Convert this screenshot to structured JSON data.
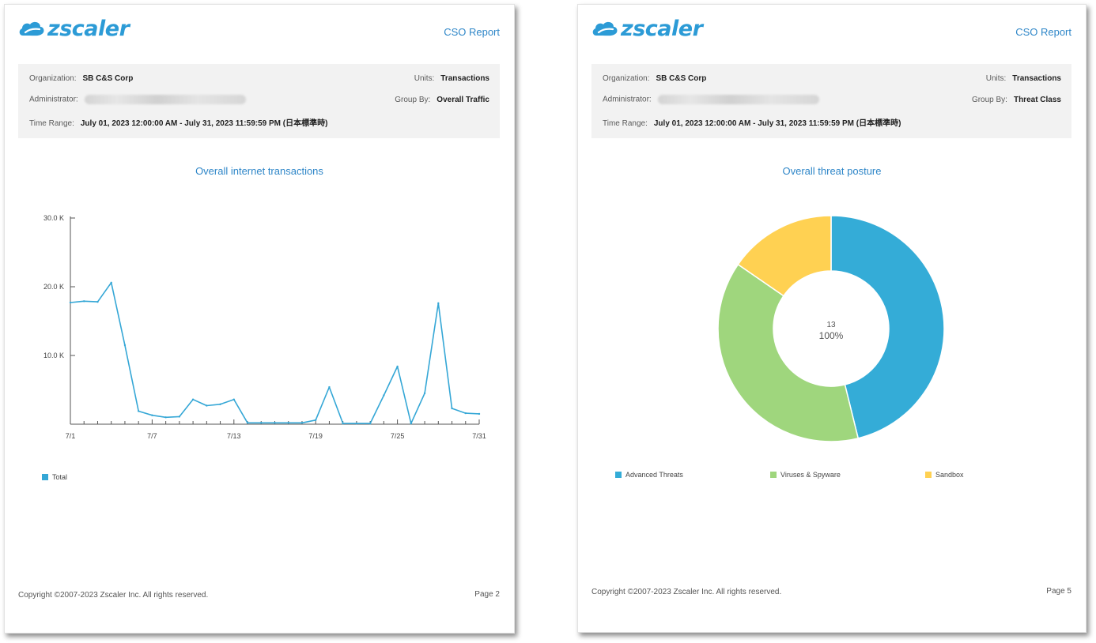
{
  "brand": {
    "name": "zscaler",
    "color": "#2c9bd6"
  },
  "left_page": {
    "report_title": "CSO Report",
    "info": {
      "org_label": "Organization:",
      "org_value": "SB C&S Corp",
      "units_label": "Units:",
      "units_value": "Transactions",
      "admin_label": "Administrator:",
      "group_label": "Group By:",
      "group_value": "Overall Traffic",
      "time_label": "Time Range:",
      "time_value": "July 01, 2023 12:00:00 AM - July 31, 2023 11:59:59 PM (日本標準時)"
    },
    "chart_title": "Overall internet transactions",
    "legend_label": "Total",
    "footer_copyright": "Copyright ©2007-2023 Zscaler Inc. All rights reserved.",
    "footer_page": "Page 2"
  },
  "right_page": {
    "report_title": "CSO Report",
    "info": {
      "org_label": "Organization:",
      "org_value": "SB C&S Corp",
      "units_label": "Units:",
      "units_value": "Transactions",
      "admin_label": "Administrator:",
      "group_label": "Group By:",
      "group_value": "Threat Class",
      "time_label": "Time Range:",
      "time_value": "July 01, 2023 12:00:00 AM - July 31, 2023 11:59:59 PM (日本標準時)"
    },
    "chart_title": "Overall threat posture",
    "center_count": "13",
    "center_percent": "100%",
    "footer_copyright": "Copyright ©2007-2023 Zscaler Inc. All rights reserved.",
    "footer_page": "Page 5"
  },
  "chart_data": [
    {
      "type": "line",
      "title": "Overall internet transactions",
      "x": [
        "7/1",
        "7/2",
        "7/3",
        "7/4",
        "7/5",
        "7/6",
        "7/7",
        "7/8",
        "7/9",
        "7/10",
        "7/11",
        "7/12",
        "7/13",
        "7/14",
        "7/15",
        "7/16",
        "7/17",
        "7/18",
        "7/19",
        "7/20",
        "7/21",
        "7/22",
        "7/23",
        "7/24",
        "7/25",
        "7/26",
        "7/27",
        "7/28",
        "7/29",
        "7/30",
        "7/31"
      ],
      "x_tick_labels": [
        "7/1",
        "7/7",
        "7/13",
        "7/19",
        "7/25",
        "7/31"
      ],
      "y_tick_labels": [
        "10.0 K",
        "20.0 K",
        "30.0 K"
      ],
      "y_ticks": [
        10000,
        20000,
        30000
      ],
      "ylim": [
        0,
        30000
      ],
      "series": [
        {
          "name": "Total",
          "color": "#35a7d6",
          "values": [
            17700,
            17900,
            17800,
            20600,
            11500,
            1900,
            1300,
            1000,
            1100,
            3600,
            2700,
            2900,
            3600,
            200,
            200,
            200,
            200,
            200,
            600,
            5400,
            100,
            100,
            100,
            4200,
            8400,
            100,
            4500,
            17600,
            2300,
            1600,
            1500
          ]
        }
      ],
      "grid": false,
      "legend": "bottom-left"
    },
    {
      "type": "pie",
      "title": "Overall threat posture",
      "total": 13,
      "labels": [
        "Advanced Threats",
        "Viruses & Spyware",
        "Sandbox"
      ],
      "values": [
        6,
        5,
        2
      ],
      "colors": [
        "#34acd7",
        "#9fd67d",
        "#ffd152"
      ],
      "legend": "bottom"
    }
  ]
}
